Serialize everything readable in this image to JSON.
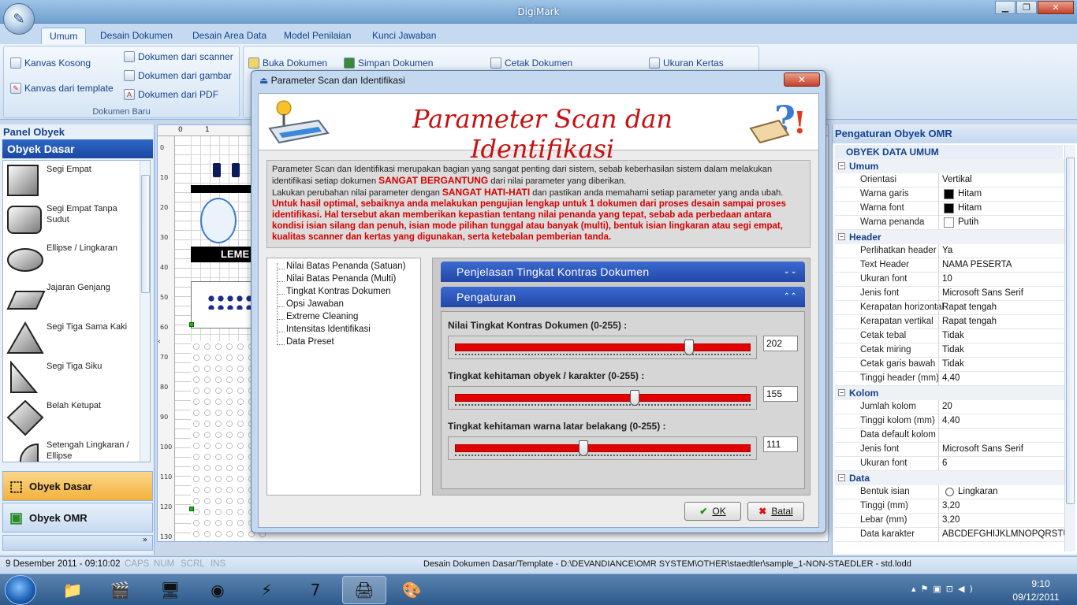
{
  "app": {
    "title": "DigiMark"
  },
  "tabs": [
    "Umum",
    "Desain Dokumen",
    "Desain Area Data",
    "Model Penilaian",
    "Kunci Jawaban"
  ],
  "ribbon": {
    "kanvas_kosong": "Kanvas Kosong",
    "kanvas_template": "Kanvas dari template",
    "dok_scanner": "Dokumen dari scanner",
    "dok_gambar": "Dokumen dari gambar",
    "dok_pdf": "Dokumen dari PDF",
    "group_label": "Dokumen Baru",
    "buka": "Buka Dokumen",
    "simpan": "Simpan Dokumen",
    "cetak": "Cetak Dokumen",
    "ukuran": "Ukuran Kertas"
  },
  "left_panel": {
    "title": "Panel Obyek",
    "subtitle": "Obyek Dasar",
    "shapes": [
      "Segi Empat",
      "Segi Empat Tanpa Sudut",
      "Ellipse / Lingkaran",
      "Jajaran Genjang",
      "Segi Tiga Sama Kaki",
      "Segi Tiga Siku",
      "Belah Ketupat",
      "Setengah Lingkaran / Ellipse"
    ],
    "nav": [
      "Obyek Dasar",
      "Obyek OMR"
    ]
  },
  "canvas": {
    "ruler_ticks": [
      "0",
      "10",
      "20",
      "30",
      "40",
      "50",
      "60",
      "70",
      "80",
      "90",
      "100",
      "110",
      "120",
      "130"
    ],
    "ruler_top": [
      "0",
      "1"
    ],
    "header_text": "LEME"
  },
  "right_panel": {
    "title": "Pengaturan Obyek OMR",
    "section": "OBYEK DATA UMUM",
    "groups": [
      {
        "name": "Umum",
        "rows": [
          [
            "Orientasi",
            "Vertikal"
          ],
          [
            "Warna garis",
            "Hitam"
          ],
          [
            "Warna font",
            "Hitam"
          ],
          [
            "Warna penanda",
            "Putih"
          ]
        ]
      },
      {
        "name": "Header",
        "rows": [
          [
            "Perlihatkan header",
            "Ya"
          ],
          [
            "Text Header",
            "NAMA PESERTA"
          ],
          [
            "Ukuran font",
            "10"
          ],
          [
            "Jenis font",
            "Microsoft Sans Serif"
          ],
          [
            "Kerapatan horizontal",
            "Rapat tengah"
          ],
          [
            "Kerapatan vertikal",
            "Rapat tengah"
          ],
          [
            "Cetak tebal",
            "Tidak"
          ],
          [
            "Cetak miring",
            "Tidak"
          ],
          [
            "Cetak garis bawah",
            "Tidak"
          ],
          [
            "Tinggi header (mm)",
            "4,40"
          ]
        ]
      },
      {
        "name": "Kolom",
        "rows": [
          [
            "Jumlah kolom",
            "20"
          ],
          [
            "Tinggi kolom (mm)",
            "4,40"
          ],
          [
            "Data default kolom",
            ""
          ],
          [
            "Jenis font",
            "Microsoft Sans Serif"
          ],
          [
            "Ukuran font",
            "6"
          ]
        ]
      },
      {
        "name": "Data",
        "rows": [
          [
            "Bentuk isian",
            "Lingkaran"
          ],
          [
            "Tinggi (mm)",
            "3,20"
          ],
          [
            "Lebar (mm)",
            "3,20"
          ],
          [
            "Data karakter",
            "ABCDEFGHIJKLMNOPQRSTU"
          ]
        ]
      }
    ]
  },
  "status": {
    "datetime": "9 Desember 2011 - 09:10:02",
    "caps": "CAPS",
    "num": "NUM",
    "scrl": "SCRL",
    "ins": "INS",
    "path": "Desain Dokumen Dasar/Template - D:\\DEVANDIANCE\\OMR SYSTEM\\OTHER\\staedtler\\sample_1-NON-STAEDLER - std.lodd"
  },
  "taskbar": {
    "time": "9:10",
    "date": "09/12/2011"
  },
  "dialog": {
    "window_title": "Parameter Scan dan Identifikasi",
    "banner": "Parameter Scan dan Identifikasi",
    "info": {
      "p1a": "Parameter Scan dan Identifikasi merupakan bagian yang sangat penting dari sistem, sebab keberhasilan sistem dalam melakukan identifikasi setiap dokumen",
      "p1b": "SANGAT BERGANTUNG",
      "p1c": "dari nilai parameter yang diberikan.",
      "p2a": "Lakukan perubahan nilai parameter dengan",
      "p2b": "SANGAT HATI-HATI",
      "p2c": "dan pastikan anda memahami setiap parameter yang anda ubah.",
      "p3": "Untuk hasil optimal, sebaiknya anda melakukan pengujian lengkap untuk 1 dokumen dari proses desain sampai proses identifikasi. Hal tersebut akan memberikan kepastian tentang nilai penanda yang tepat, sebab ada perbedaan antara kondisi isian silang dan penuh, isian mode pilihan tunggal atau banyak (multi), bentuk isian lingkaran atau segi empat, kualitas scanner dan kertas yang digunakan, serta ketebalan pemberian tanda."
    },
    "tree": [
      "Nilai Batas Penanda (Satuan)",
      "Nilai Batas Penanda (Multi)",
      "Tingkat Kontras Dokumen",
      "Opsi Jawaban",
      "Extreme Cleaning",
      "Intensitas Identifikasi",
      "Data Preset"
    ],
    "bar1": "Penjelasan Tingkat Kontras Dokumen",
    "bar2": "Pengaturan",
    "sliders": [
      {
        "label": "Nilai Tingkat Kontras Dokumen (0-255) :",
        "value": "202",
        "fraction": 0.792
      },
      {
        "label": "Tingkat kehitaman obyek / karakter (0-255) :",
        "value": "155",
        "fraction": 0.608
      },
      {
        "label": "Tingkat kehitaman warna latar belakang (0-255) :",
        "value": "111",
        "fraction": 0.435
      }
    ],
    "ok": "OK",
    "cancel": "Batal"
  }
}
